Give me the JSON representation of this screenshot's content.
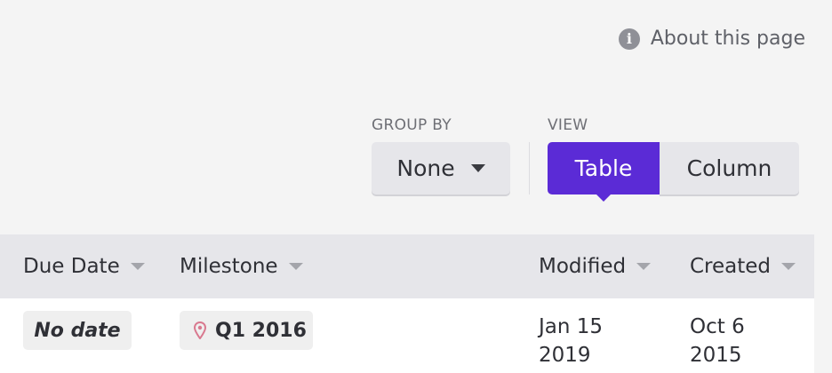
{
  "header": {
    "about_label": "About this page",
    "about_icon": "info-icon"
  },
  "controls": {
    "group_by_label": "GROUP BY",
    "group_by_value": "None",
    "view_label": "VIEW",
    "view_options": [
      "Table",
      "Column"
    ],
    "view_selected": "Table",
    "accent_color": "#5b2bd6"
  },
  "table": {
    "columns": [
      "Due Date",
      "Milestone",
      "Modified",
      "Created"
    ],
    "rows": [
      {
        "due_date": "No date",
        "milestone": "Q1 2016",
        "milestone_icon": "location-pin-icon",
        "modified_line1": "Jan 15",
        "modified_line2": "2019",
        "created_line1": "Oct 6",
        "created_line2": "2015"
      }
    ]
  }
}
